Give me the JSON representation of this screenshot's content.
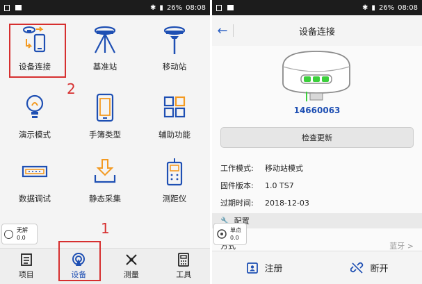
{
  "status_bar": {
    "battery": "26%",
    "time": "08:08"
  },
  "left_screen": {
    "tiles": [
      {
        "label": "设备连接",
        "icon": "device-connect-icon"
      },
      {
        "label": "基准站",
        "icon": "base-station-icon"
      },
      {
        "label": "移动站",
        "icon": "rover-station-icon"
      },
      {
        "label": "演示模式",
        "icon": "lightbulb-icon"
      },
      {
        "label": "手簿类型",
        "icon": "handheld-icon"
      },
      {
        "label": "辅助功能",
        "icon": "grid-tools-icon"
      },
      {
        "label": "数据调试",
        "icon": "serial-port-icon"
      },
      {
        "label": "静态采集",
        "icon": "download-icon"
      },
      {
        "label": "测距仪",
        "icon": "rangefinder-icon"
      }
    ],
    "annotations": {
      "num_1": "1",
      "num_2": "2"
    },
    "solution_widget": {
      "status": "无解",
      "value": "0.0"
    },
    "bottom_nav": [
      {
        "label": "项目",
        "icon": "project-icon"
      },
      {
        "label": "设备",
        "icon": "device-icon",
        "active": true
      },
      {
        "label": "测量",
        "icon": "survey-icon"
      },
      {
        "label": "工具",
        "icon": "tools-icon"
      }
    ]
  },
  "right_screen": {
    "title": "设备连接",
    "serial": "14660063",
    "check_update_label": "检查更新",
    "info": [
      {
        "key": "工作模式:",
        "value": "移动站模式"
      },
      {
        "key": "固件版本:",
        "value": "1.0  TS7"
      },
      {
        "key": "过期时间:",
        "value": "2018-12-03"
      }
    ],
    "config_label": "配置",
    "solution_widget": {
      "status": "单点",
      "value": "0.0"
    },
    "mode_label": "方式",
    "mode_value": "蓝牙 >",
    "register_label": "注册",
    "disconnect_label": "断开"
  },
  "colors": {
    "accent": "#1e4fb3",
    "annotation_red": "#d62f2f",
    "led_green": "#3ccf3c"
  }
}
